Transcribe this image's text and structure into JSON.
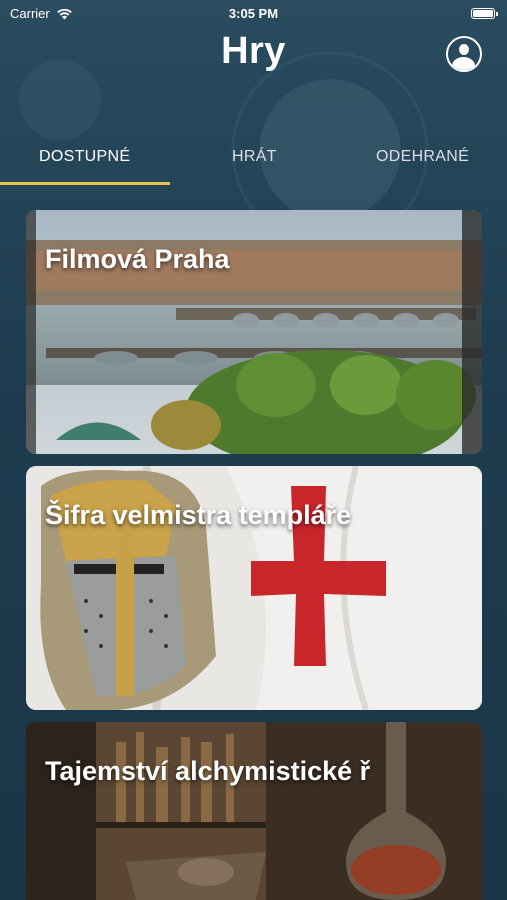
{
  "status_bar": {
    "carrier": "Carrier",
    "time": "3:05 PM"
  },
  "header": {
    "title": "Hry",
    "profile_icon": "user-circle-icon"
  },
  "tabs": [
    {
      "label": "DOSTUPNÉ",
      "active": true
    },
    {
      "label": "HRÁT",
      "active": false
    },
    {
      "label": "ODEHRANÉ",
      "active": false
    }
  ],
  "games": [
    {
      "title": "Filmová Praha"
    },
    {
      "title": "Šifra velmistra templáře"
    },
    {
      "title": "Tajemství alchymistické ř"
    }
  ],
  "colors": {
    "background": "#1f3f52",
    "tab_underline": "#e6c34a",
    "text": "#ffffff"
  }
}
